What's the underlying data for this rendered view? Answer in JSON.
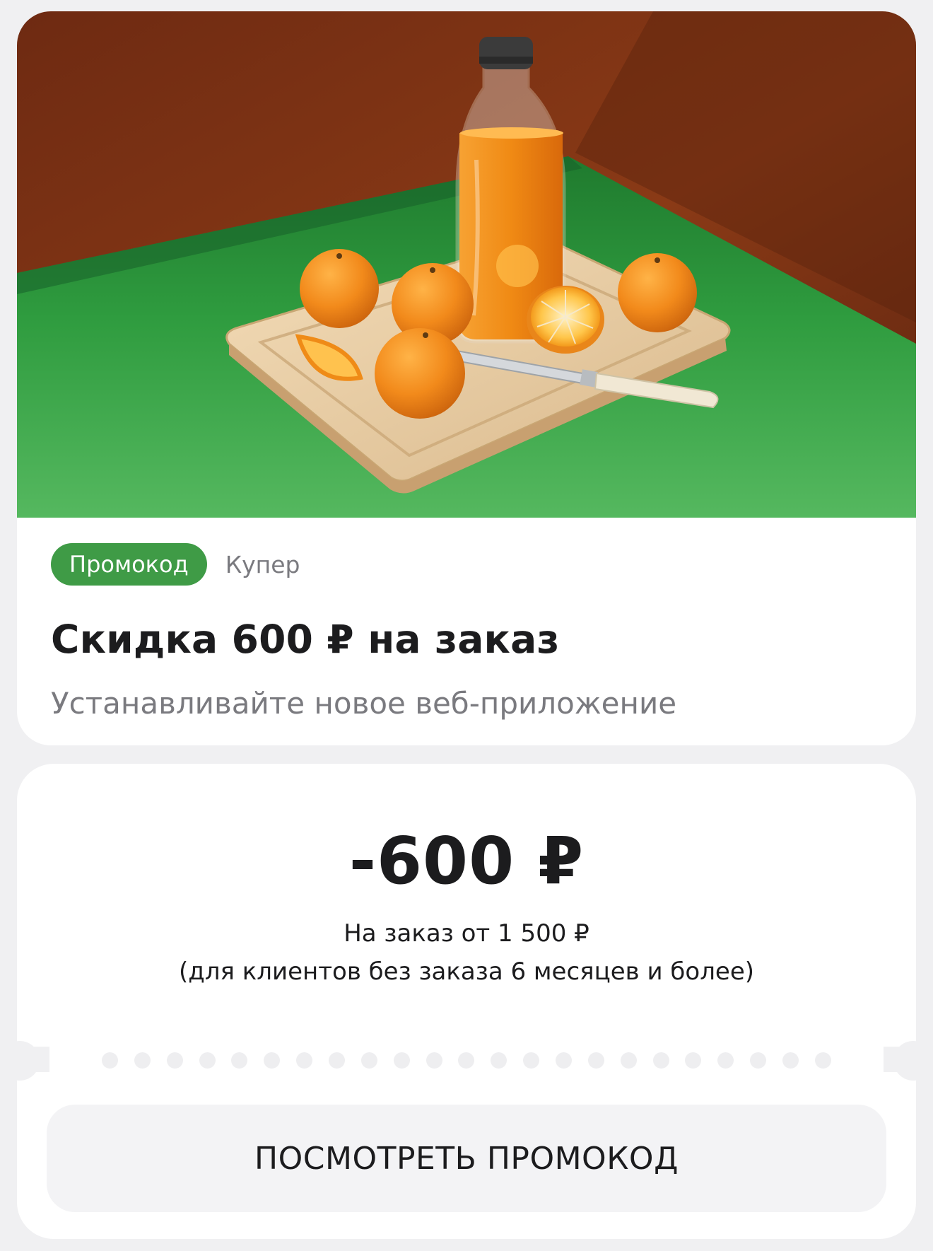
{
  "promo": {
    "badge_label": "Промокод",
    "store_name": "Купер",
    "title": "Скидка 600 ₽ на заказ",
    "subtitle": "Устанавливайте новое веб-приложение",
    "hero_image_description": "orange-juice-bottle-and-oranges-on-cutting-board"
  },
  "coupon": {
    "amount": "-600 ₽",
    "condition_line1": "На заказ от 1 500 ₽",
    "condition_line2": "(для клиентов без заказа 6 месяцев и более)",
    "button_label": "ПОСМОТРЕТЬ ПРОМОКОД"
  },
  "colors": {
    "page_background": "#f0f0f2",
    "badge_green": "#3f9b46",
    "secondary_text": "#7a7a7f",
    "primary_text": "#1c1c1e",
    "button_background": "#f3f3f5",
    "hero_wall": "#7a3414",
    "hero_table": "#2f9a3e",
    "hero_juice": "#f08a14"
  }
}
